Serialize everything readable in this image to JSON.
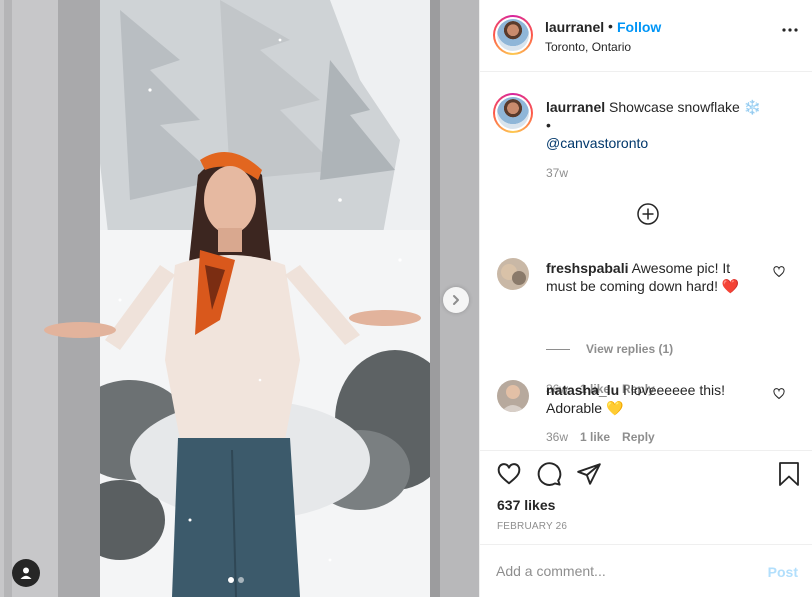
{
  "post": {
    "username": "laurranel",
    "separator": "•",
    "follow_label": "Follow",
    "location": "Toronto, Ontario"
  },
  "media": {
    "image_description_icon": "photo",
    "carousel_index": 1,
    "carousel_count": 2
  },
  "caption": {
    "username": "laurranel",
    "text": "Showcase snowflake",
    "emoji": "❄️",
    "bullet": "•",
    "mention": "@canvastoronto",
    "time": "37w"
  },
  "comments": [
    {
      "username": "freshspabali",
      "text": "Awesome pic! It must be coming down hard!",
      "emoji": "❤️",
      "time": "36w",
      "likes": "1 like",
      "reply_label": "Reply",
      "view_replies": "View replies (1)"
    },
    {
      "username": "natasha_lu",
      "text": "I loveeeeee this! Adorable",
      "emoji": "💛",
      "time": "36w",
      "likes": "1 like",
      "reply_label": "Reply"
    }
  ],
  "likes_text": "637 likes",
  "date_text": "FEBRUARY 26",
  "add_comment": {
    "placeholder": "Add a comment...",
    "post_label": "Post"
  },
  "colors": {
    "link_blue": "#0095f6",
    "post_disabled": "#b2dffc",
    "mention": "#00376b",
    "muted": "#8e8e8e",
    "heart_red": "#ed4956",
    "heart_yellow": "#fdd835"
  }
}
